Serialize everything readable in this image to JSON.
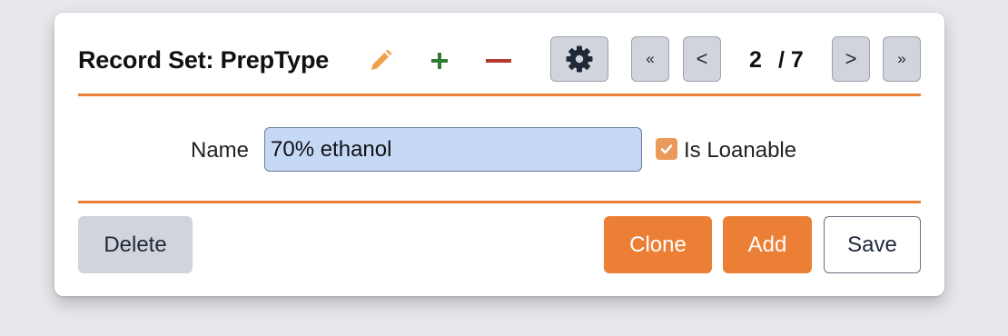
{
  "header": {
    "title": "Record Set: PrepType",
    "edit_icon": "pencil-icon",
    "add_icon": "plus-icon",
    "remove_icon": "minus-icon",
    "settings_icon": "gear-icon",
    "pager": {
      "first": "«",
      "prev": "<",
      "current": "2",
      "separator": "/",
      "total": "7",
      "next": ">",
      "last": "»"
    }
  },
  "form": {
    "name_label": "Name",
    "name_value": "70% ethanol",
    "is_loanable_label": "Is Loanable",
    "is_loanable_checked": true
  },
  "footer": {
    "delete_label": "Delete",
    "clone_label": "Clone",
    "add_label": "Add",
    "save_label": "Save"
  },
  "colors": {
    "accent": "#ec7f36",
    "edit_icon": "#f0a04b",
    "add_icon": "#2e7d32",
    "remove_icon": "#b23a2f",
    "input_bg": "#c5d9f7",
    "neutral_button": "#d1d5db"
  }
}
